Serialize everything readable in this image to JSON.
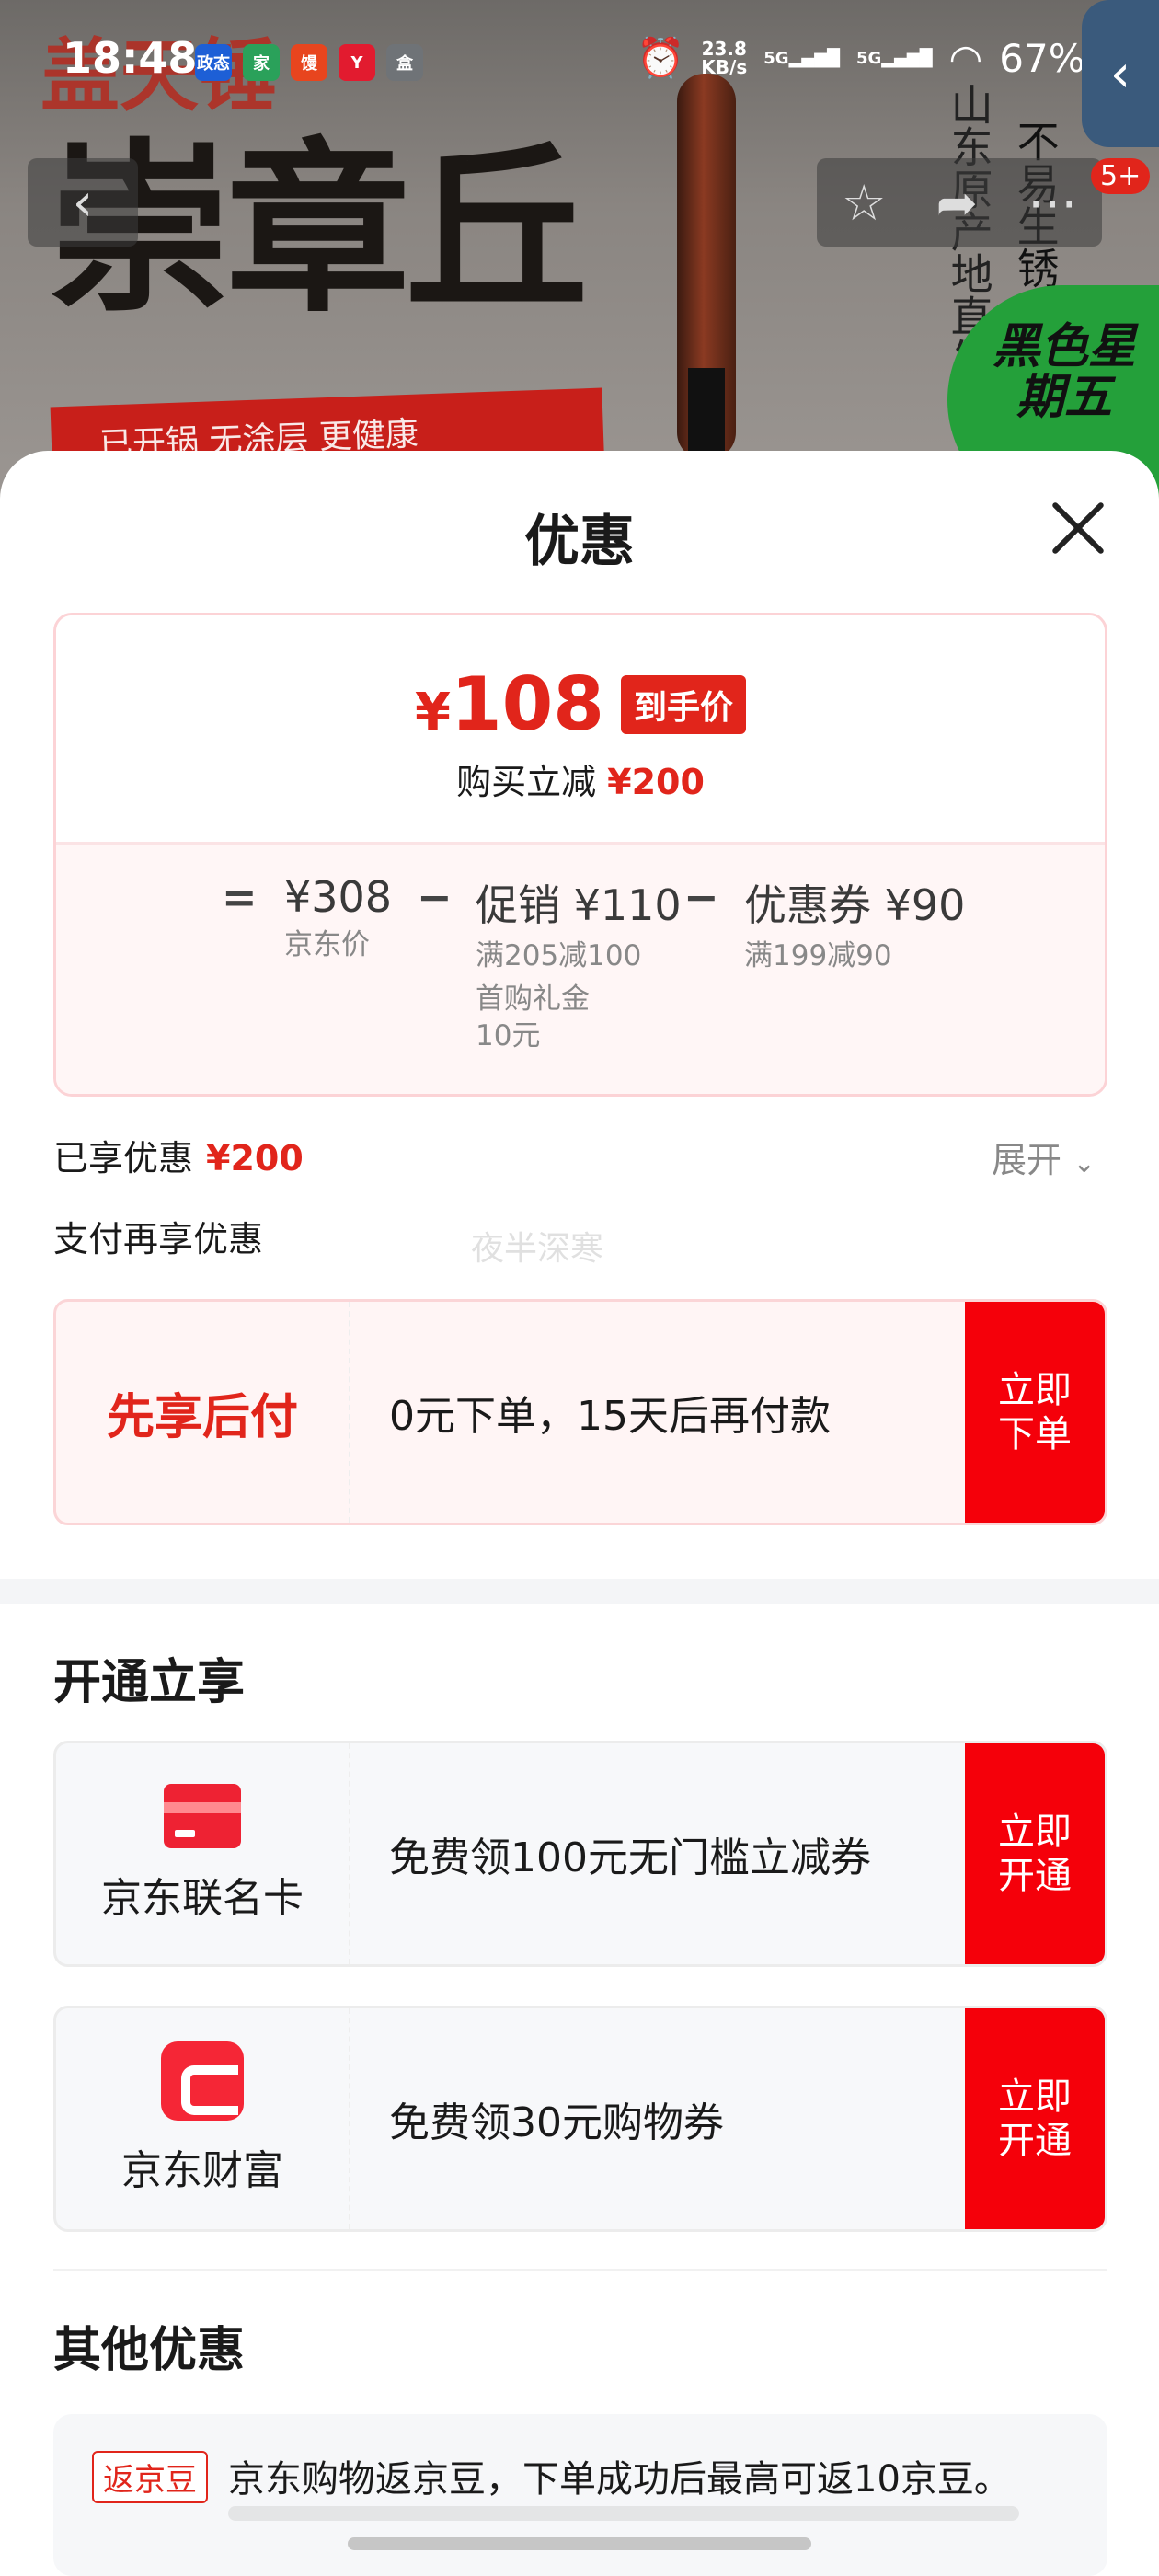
{
  "status_bar": {
    "time": "18:48",
    "app_icons": [
      "政态",
      "家",
      "馒",
      "Y",
      "盒"
    ],
    "net_speed_value": "23.8",
    "net_speed_unit": "KB/s",
    "signal1": "5G",
    "signal2": "5G",
    "battery": "67%"
  },
  "background": {
    "title_text": "崇章丘",
    "top_text": "盖天锤",
    "ribbon_text": "已开锅 无涂层 更健康",
    "vertical_text_1": "山东原产地直发",
    "vertical_text_2": "不易生锈",
    "green_badge": "黑色星期五"
  },
  "nav": {
    "badge": "5+"
  },
  "sheet": {
    "title": "优惠",
    "final_price_symbol": "¥",
    "final_price": "108",
    "final_price_tag": "到手价",
    "reduce_label": "购买立减",
    "reduce_amount": "¥200",
    "calc": {
      "eq": "=",
      "minus": "−",
      "jd_price": "¥308",
      "jd_price_label": "京东价",
      "promo": "促销 ¥110",
      "promo_sub1": "满205减100",
      "promo_sub2": "首购礼金",
      "promo_sub3": "10元",
      "coupon": "优惠券 ¥90",
      "coupon_sub": "满199减90"
    },
    "enjoyed_label": "已享优惠",
    "enjoyed_amount": "¥200",
    "expand_label": "展开",
    "pay_more_label": "支付再享优惠",
    "watermark": "夜半深寒",
    "pay_offer": {
      "left": "先享后付",
      "desc": "0元下单，15天后再付款",
      "btn_line1": "立即",
      "btn_line2": "下单"
    },
    "open_title": "开通立享",
    "card_offer": {
      "name": "京东联名卡",
      "desc": "免费领100元无门槛立减券",
      "btn_line1": "立即",
      "btn_line2": "开通"
    },
    "wealth_offer": {
      "name": "京东财富",
      "desc": "免费领30元购物券",
      "btn_line1": "立即",
      "btn_line2": "开通"
    },
    "other_title": "其他优惠",
    "other_tag": "返京豆",
    "other_text": "京东购物返京豆，下单成功后最高可返10京豆。"
  },
  "colors": {
    "accent": "#e1251b",
    "button_red": "#f5000a",
    "section_bg": "#f4f5f7"
  }
}
